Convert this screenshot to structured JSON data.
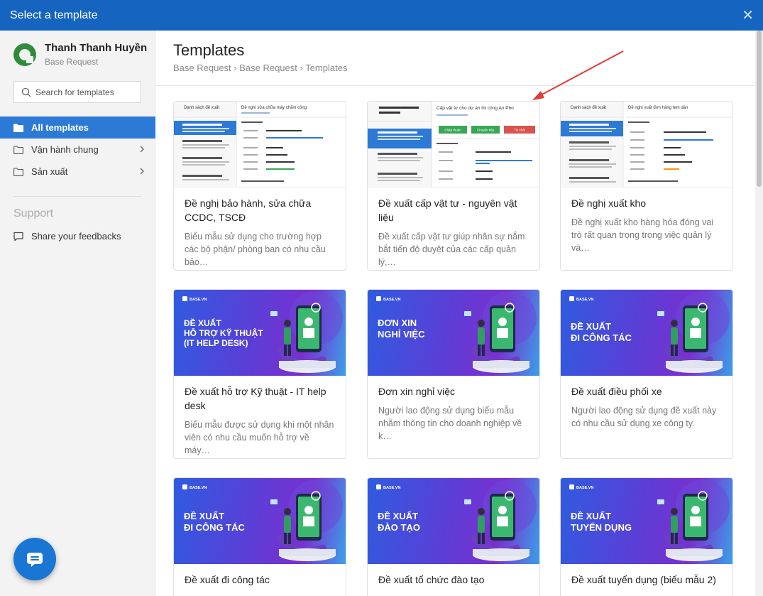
{
  "window": {
    "title": "Select a template",
    "close_glyph": "✕"
  },
  "user": {
    "name": "Thanh Thanh Huyền",
    "subtitle": "Base Request"
  },
  "search": {
    "placeholder": "Search for templates"
  },
  "sidebar": {
    "items": [
      {
        "label": "All templates",
        "icon": "folder-filled-icon",
        "active": true
      },
      {
        "label": "Vận hành chung",
        "icon": "folder-icon",
        "has_children": true
      },
      {
        "label": "Sản xuất",
        "icon": "folder-icon",
        "has_children": true
      }
    ],
    "support_heading": "Support",
    "feedback_label": "Share your feedbacks"
  },
  "main": {
    "title": "Templates",
    "breadcrumb": "Base Request › Base Request › Templates"
  },
  "colors": {
    "topbar": "#1565c0",
    "active_nav": "#2d7ad6",
    "chat_button": "#1976d2",
    "arrow": "#e53935"
  },
  "cards": [
    {
      "title": "Đề nghị bảo hành, sửa chữa CCDC, TSCĐ",
      "desc": "Biểu mẫu sử dụng cho trường hợp các bộ phận/ phòng ban có nhu cầu bảo…",
      "preview": "screenshot"
    },
    {
      "title": "Đề xuất cấp vật tư - nguyên vật liệu",
      "desc": "Đề xuất cấp vật tư giúp nhân sự nắm bắt tiến độ duyệt của các cấp quản lý,…",
      "preview": "screenshot"
    },
    {
      "title": "Đề nghị xuất kho",
      "desc": "Đề nghị xuất kho hàng hóa đóng vai trò rất quan trọng trong việc quản lý và…",
      "preview": "screenshot"
    },
    {
      "title": "Đề xuất hỗ trợ Kỹ thuật - IT help desk",
      "desc": "Biểu mẫu được sử dụng khi một nhân viên có nhu cầu muốn hỗ trợ về máy…",
      "preview": "banner",
      "banner_lines": [
        "ĐỀ XUẤT",
        "HỖ TRỢ KỸ THUẬT",
        "(IT HELP DESK)"
      ]
    },
    {
      "title": "Đơn xin nghỉ việc",
      "desc": "Người lao động sử dụng biểu mẫu nhằm thông tin cho doanh nghiệp về k…",
      "preview": "banner",
      "banner_lines": [
        "ĐƠN XIN",
        "NGHỈ VIỆC"
      ]
    },
    {
      "title": "Đề xuất điều phối xe",
      "desc": "Người lao động sử dụng đề xuất này có nhu cầu sử dụng xe công ty.",
      "preview": "banner",
      "banner_lines": [
        "ĐỀ XUẤT",
        "ĐI CÔNG TÁC"
      ]
    },
    {
      "title": "Đề xuất đi công tác",
      "desc": "",
      "preview": "banner",
      "banner_lines": [
        "ĐỀ XUẤT",
        "ĐI CÔNG TÁC"
      ]
    },
    {
      "title": "Đề xuất tổ chức đào tạo",
      "desc": "",
      "preview": "banner",
      "banner_lines": [
        "ĐỀ XUẤT",
        "ĐÀO TẠO"
      ]
    },
    {
      "title": "Đề xuất tuyển dụng (biểu mẫu 2)",
      "desc": "",
      "preview": "banner",
      "banner_lines": [
        "ĐỀ XUẤT",
        "TUYỂN DỤNG"
      ]
    }
  ],
  "previews": [
    {
      "list_title": "Danh sách đề xuất",
      "detail_title": "Đề nghị sửa chữa máy chấm công"
    },
    {
      "list_title": "Đề xuất cấp vật tư - nguyên vật liệu",
      "detail_title": "Cấp vật tư cho dự án thi công An Phú",
      "buttons": [
        "Chấp thuận",
        "Chuyển tiếp",
        "Từ chối"
      ]
    },
    {
      "list_title": "Danh sách đề xuất",
      "detail_title": "Đề nghị xuất đơn hàng tem dán"
    }
  ],
  "brand_label": "BASE.VN"
}
